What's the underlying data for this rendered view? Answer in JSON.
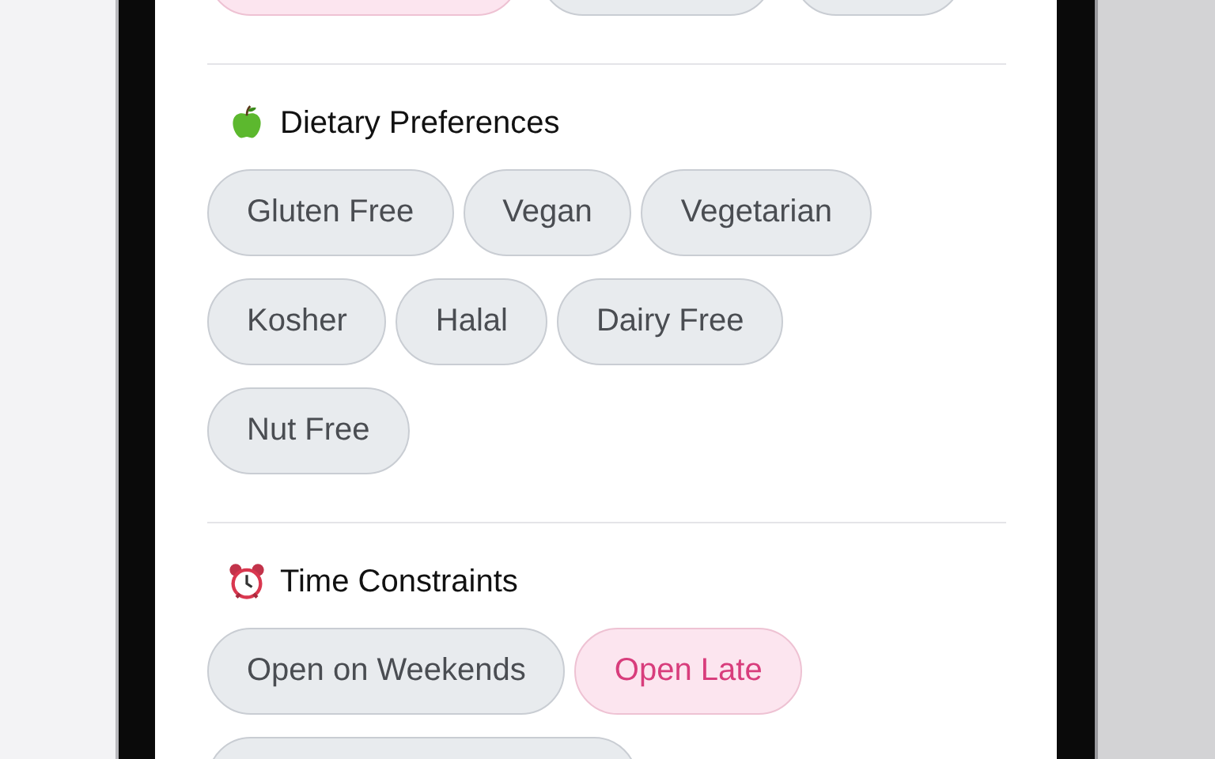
{
  "sections": [
    {
      "chips": [
        {
          "selected": true
        },
        {
          "selected": false
        },
        {
          "selected": false
        }
      ]
    },
    {
      "title": "Dietary Preferences",
      "chips": [
        {
          "label": "Gluten Free",
          "selected": false
        },
        {
          "label": "Vegan",
          "selected": false
        },
        {
          "label": "Vegetarian",
          "selected": false
        },
        {
          "label": "Kosher",
          "selected": false
        },
        {
          "label": "Halal",
          "selected": false
        },
        {
          "label": "Dairy Free",
          "selected": false
        },
        {
          "label": "Nut Free",
          "selected": false
        }
      ]
    },
    {
      "title": "Time Constraints",
      "chips": [
        {
          "label": "Open on Weekends",
          "selected": false
        },
        {
          "label": "Open Late",
          "selected": true
        },
        {
          "selected": false
        }
      ]
    }
  ]
}
